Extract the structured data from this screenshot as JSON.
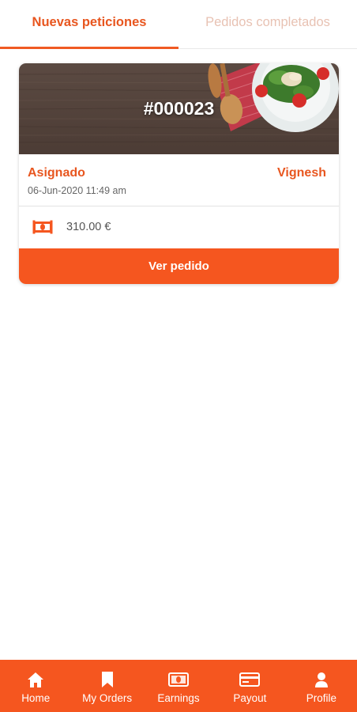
{
  "tabs": [
    {
      "label": "Nuevas peticiones",
      "active": true
    },
    {
      "label": "Pedidos completados",
      "active": false
    }
  ],
  "order": {
    "number": "#000023",
    "status": "Asignado",
    "customer": "Vignesh",
    "datetime": "06-Jun-2020 11:49 am",
    "amount": "310.00 €",
    "button_label": "Ver pedido"
  },
  "bottom_nav": [
    {
      "label": "Home",
      "icon": "home-icon"
    },
    {
      "label": "My Orders",
      "icon": "bookmark-icon"
    },
    {
      "label": "Earnings",
      "icon": "cash-icon"
    },
    {
      "label": "Payout",
      "icon": "credit-card-icon"
    },
    {
      "label": "Profile",
      "icon": "user-icon"
    }
  ],
  "colors": {
    "accent": "#f5561f",
    "accent_text": "#e8561f",
    "inactive_tab": "#e8c2b3"
  }
}
